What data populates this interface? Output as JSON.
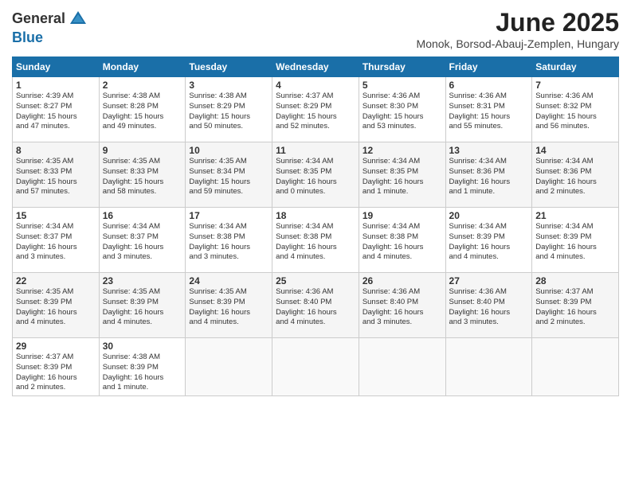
{
  "header": {
    "logo_line1": "General",
    "logo_line2": "Blue",
    "main_title": "June 2025",
    "subtitle": "Monok, Borsod-Abauj-Zemplen, Hungary"
  },
  "weekdays": [
    "Sunday",
    "Monday",
    "Tuesday",
    "Wednesday",
    "Thursday",
    "Friday",
    "Saturday"
  ],
  "weeks": [
    [
      {
        "day": "1",
        "info": "Sunrise: 4:39 AM\nSunset: 8:27 PM\nDaylight: 15 hours\nand 47 minutes."
      },
      {
        "day": "2",
        "info": "Sunrise: 4:38 AM\nSunset: 8:28 PM\nDaylight: 15 hours\nand 49 minutes."
      },
      {
        "day": "3",
        "info": "Sunrise: 4:38 AM\nSunset: 8:29 PM\nDaylight: 15 hours\nand 50 minutes."
      },
      {
        "day": "4",
        "info": "Sunrise: 4:37 AM\nSunset: 8:29 PM\nDaylight: 15 hours\nand 52 minutes."
      },
      {
        "day": "5",
        "info": "Sunrise: 4:36 AM\nSunset: 8:30 PM\nDaylight: 15 hours\nand 53 minutes."
      },
      {
        "day": "6",
        "info": "Sunrise: 4:36 AM\nSunset: 8:31 PM\nDaylight: 15 hours\nand 55 minutes."
      },
      {
        "day": "7",
        "info": "Sunrise: 4:36 AM\nSunset: 8:32 PM\nDaylight: 15 hours\nand 56 minutes."
      }
    ],
    [
      {
        "day": "8",
        "info": "Sunrise: 4:35 AM\nSunset: 8:33 PM\nDaylight: 15 hours\nand 57 minutes."
      },
      {
        "day": "9",
        "info": "Sunrise: 4:35 AM\nSunset: 8:33 PM\nDaylight: 15 hours\nand 58 minutes."
      },
      {
        "day": "10",
        "info": "Sunrise: 4:35 AM\nSunset: 8:34 PM\nDaylight: 15 hours\nand 59 minutes."
      },
      {
        "day": "11",
        "info": "Sunrise: 4:34 AM\nSunset: 8:35 PM\nDaylight: 16 hours\nand 0 minutes."
      },
      {
        "day": "12",
        "info": "Sunrise: 4:34 AM\nSunset: 8:35 PM\nDaylight: 16 hours\nand 1 minute."
      },
      {
        "day": "13",
        "info": "Sunrise: 4:34 AM\nSunset: 8:36 PM\nDaylight: 16 hours\nand 1 minute."
      },
      {
        "day": "14",
        "info": "Sunrise: 4:34 AM\nSunset: 8:36 PM\nDaylight: 16 hours\nand 2 minutes."
      }
    ],
    [
      {
        "day": "15",
        "info": "Sunrise: 4:34 AM\nSunset: 8:37 PM\nDaylight: 16 hours\nand 3 minutes."
      },
      {
        "day": "16",
        "info": "Sunrise: 4:34 AM\nSunset: 8:37 PM\nDaylight: 16 hours\nand 3 minutes."
      },
      {
        "day": "17",
        "info": "Sunrise: 4:34 AM\nSunset: 8:38 PM\nDaylight: 16 hours\nand 3 minutes."
      },
      {
        "day": "18",
        "info": "Sunrise: 4:34 AM\nSunset: 8:38 PM\nDaylight: 16 hours\nand 4 minutes."
      },
      {
        "day": "19",
        "info": "Sunrise: 4:34 AM\nSunset: 8:38 PM\nDaylight: 16 hours\nand 4 minutes."
      },
      {
        "day": "20",
        "info": "Sunrise: 4:34 AM\nSunset: 8:39 PM\nDaylight: 16 hours\nand 4 minutes."
      },
      {
        "day": "21",
        "info": "Sunrise: 4:34 AM\nSunset: 8:39 PM\nDaylight: 16 hours\nand 4 minutes."
      }
    ],
    [
      {
        "day": "22",
        "info": "Sunrise: 4:35 AM\nSunset: 8:39 PM\nDaylight: 16 hours\nand 4 minutes."
      },
      {
        "day": "23",
        "info": "Sunrise: 4:35 AM\nSunset: 8:39 PM\nDaylight: 16 hours\nand 4 minutes."
      },
      {
        "day": "24",
        "info": "Sunrise: 4:35 AM\nSunset: 8:39 PM\nDaylight: 16 hours\nand 4 minutes."
      },
      {
        "day": "25",
        "info": "Sunrise: 4:36 AM\nSunset: 8:40 PM\nDaylight: 16 hours\nand 4 minutes."
      },
      {
        "day": "26",
        "info": "Sunrise: 4:36 AM\nSunset: 8:40 PM\nDaylight: 16 hours\nand 3 minutes."
      },
      {
        "day": "27",
        "info": "Sunrise: 4:36 AM\nSunset: 8:40 PM\nDaylight: 16 hours\nand 3 minutes."
      },
      {
        "day": "28",
        "info": "Sunrise: 4:37 AM\nSunset: 8:39 PM\nDaylight: 16 hours\nand 2 minutes."
      }
    ],
    [
      {
        "day": "29",
        "info": "Sunrise: 4:37 AM\nSunset: 8:39 PM\nDaylight: 16 hours\nand 2 minutes."
      },
      {
        "day": "30",
        "info": "Sunrise: 4:38 AM\nSunset: 8:39 PM\nDaylight: 16 hours\nand 1 minute."
      },
      {
        "day": "",
        "info": ""
      },
      {
        "day": "",
        "info": ""
      },
      {
        "day": "",
        "info": ""
      },
      {
        "day": "",
        "info": ""
      },
      {
        "day": "",
        "info": ""
      }
    ]
  ]
}
